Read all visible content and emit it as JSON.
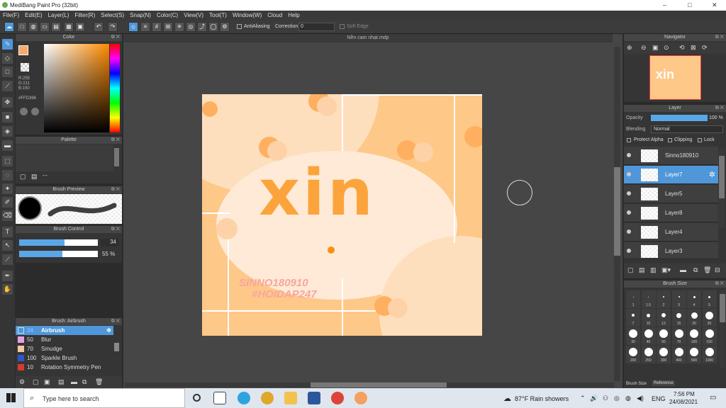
{
  "title": "MediBang Paint Pro (32bit)",
  "window_controls": [
    "–",
    "□",
    "✕"
  ],
  "menus": [
    "File(F)",
    "Edit(E)",
    "Layer(L)",
    "Filter(R)",
    "Select(S)",
    "Snap(N)",
    "Color(C)",
    "View(V)",
    "Tool(T)",
    "Window(W)",
    "Cloud",
    "Help"
  ],
  "toolbar": {
    "antialias_label": "AntiAliasing",
    "correction_label": "Correction",
    "correction_value": "0",
    "soft_edge_label": "Soft Edge"
  },
  "doc_tab": "Nền cam nhạt.mdp",
  "color_panel": {
    "title": "Color",
    "r": "R:255",
    "g": "G:211",
    "b": "B:150",
    "hex": "#FFD396"
  },
  "palette_panel": {
    "title": "Palette",
    "dash": "---"
  },
  "brush_preview": {
    "title": "Brush Preview"
  },
  "brush_control": {
    "title": "Brush Control",
    "size": "34",
    "opacity": "55 %"
  },
  "brush_list": {
    "title": "Brush: Airbrush",
    "items": [
      {
        "size": "34",
        "name": "Airbrush",
        "color": "#4f97d8"
      },
      {
        "size": "50",
        "name": "Blur",
        "color": "#e6a0e0"
      },
      {
        "size": "70",
        "name": "Smudge",
        "color": "#f2c9a0"
      },
      {
        "size": "100",
        "name": "Sparkle Brush",
        "color": "#2f55c8"
      },
      {
        "size": "10",
        "name": "Rotation Symmetry Pen",
        "color": "#d83a2a"
      }
    ]
  },
  "artwork": {
    "word": "xin",
    "signature": "SINNO180910",
    "hashtag": "#HOIDAP247"
  },
  "navigator": {
    "title": "Navigator"
  },
  "layer_panel": {
    "title": "Layer",
    "opacity_label": "Opacity",
    "opacity_value": "100 %",
    "opacity": 1.0,
    "blending_label": "Blending",
    "blending_value": "Normal",
    "protect_alpha": "Protect Alpha",
    "clipping": "Clipping",
    "lock": "Lock",
    "layers": [
      "Sinno180910",
      "Layer7",
      "Layer5",
      "Layer8",
      "Layer4",
      "Layer3"
    ],
    "selected": "Layer7"
  },
  "brush_size": {
    "title": "Brush Size",
    "row_labels": [
      [
        "1",
        "1.5",
        "2",
        "3",
        "4",
        "5"
      ],
      [
        "7",
        "10",
        "12",
        "15",
        "20",
        "25"
      ],
      [
        "30",
        "40",
        "50",
        "70",
        "100",
        "150"
      ],
      [
        "200",
        "250",
        "300",
        "400",
        "500",
        "1000"
      ]
    ],
    "tabs": [
      "Brush Size",
      "Reference"
    ]
  },
  "taskbar": {
    "search_placeholder": "Type here to search",
    "weather": "87°F  Rain showers",
    "lang": "ENG",
    "time": "7:56 PM",
    "date": "24/08/2021"
  }
}
